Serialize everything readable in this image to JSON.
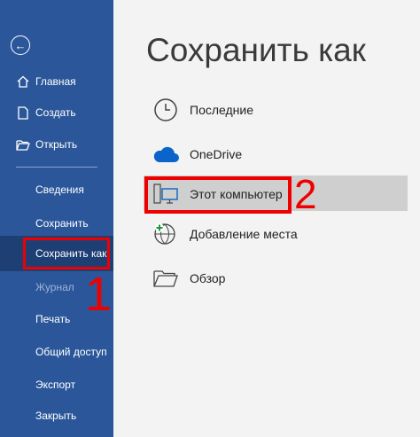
{
  "sidebar": {
    "back_icon": "back-arrow-icon",
    "top_items": [
      {
        "label": "Главная",
        "icon": "home-icon"
      },
      {
        "label": "Создать",
        "icon": "new-document-icon"
      },
      {
        "label": "Открыть",
        "icon": "open-folder-icon"
      }
    ],
    "items": [
      {
        "label": "Сведения"
      },
      {
        "label": "Сохранить"
      },
      {
        "label": "Сохранить как"
      },
      {
        "label": "Журнал"
      },
      {
        "label": "Печать"
      },
      {
        "label": "Общий доступ"
      },
      {
        "label": "Экспорт"
      },
      {
        "label": "Закрыть"
      }
    ]
  },
  "annotations": {
    "num1": "1",
    "num2": "2",
    "color": "#e00000"
  },
  "main": {
    "title": "Сохранить как",
    "options": [
      {
        "label": "Последние",
        "icon": "clock-icon"
      },
      {
        "label": "OneDrive",
        "icon": "cloud-icon"
      },
      {
        "label": "Этот компьютер",
        "icon": "computer-icon"
      },
      {
        "label": "Добавление места",
        "icon": "add-location-icon"
      },
      {
        "label": "Обзор",
        "icon": "folder-icon"
      }
    ]
  },
  "colors": {
    "sidebar": "#2b579a",
    "sidebar_active": "#1e3f74",
    "background": "#f3f3f3",
    "highlight": "#cfcfcf"
  }
}
